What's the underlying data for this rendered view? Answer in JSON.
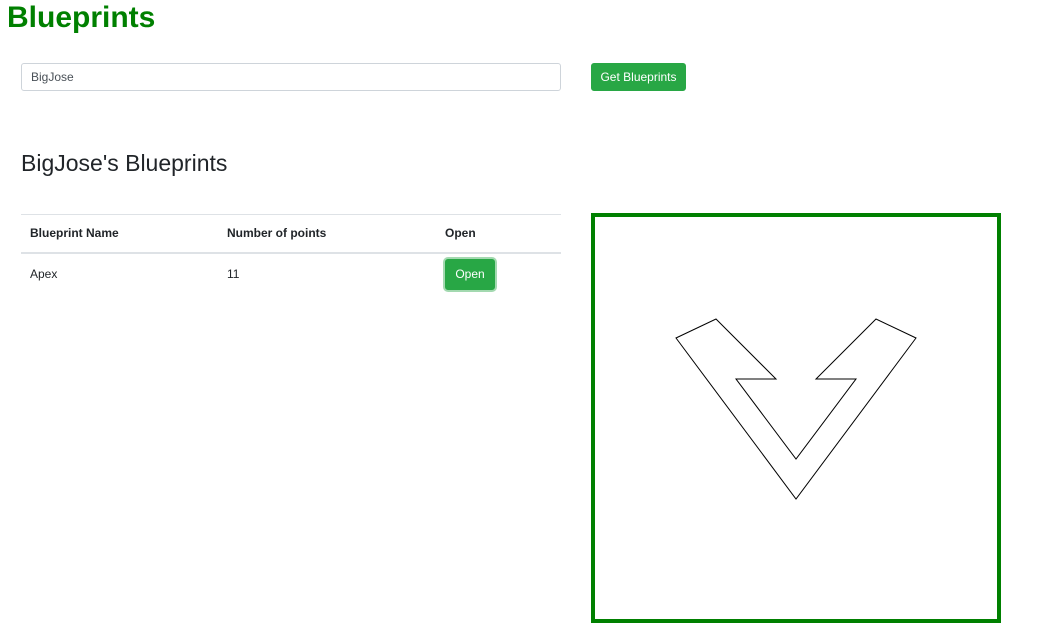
{
  "app": {
    "title": "Blueprints"
  },
  "search": {
    "value": "BigJose",
    "button_label": "Get Blueprints"
  },
  "section": {
    "title": "BigJose's Blueprints"
  },
  "table": {
    "headers": [
      "Blueprint Name",
      "Number of points",
      "Open"
    ],
    "rows": [
      {
        "name": "Apex",
        "points": "11",
        "open_label": "Open"
      }
    ]
  },
  "colors": {
    "accent": "#008000",
    "button": "#28a745"
  }
}
